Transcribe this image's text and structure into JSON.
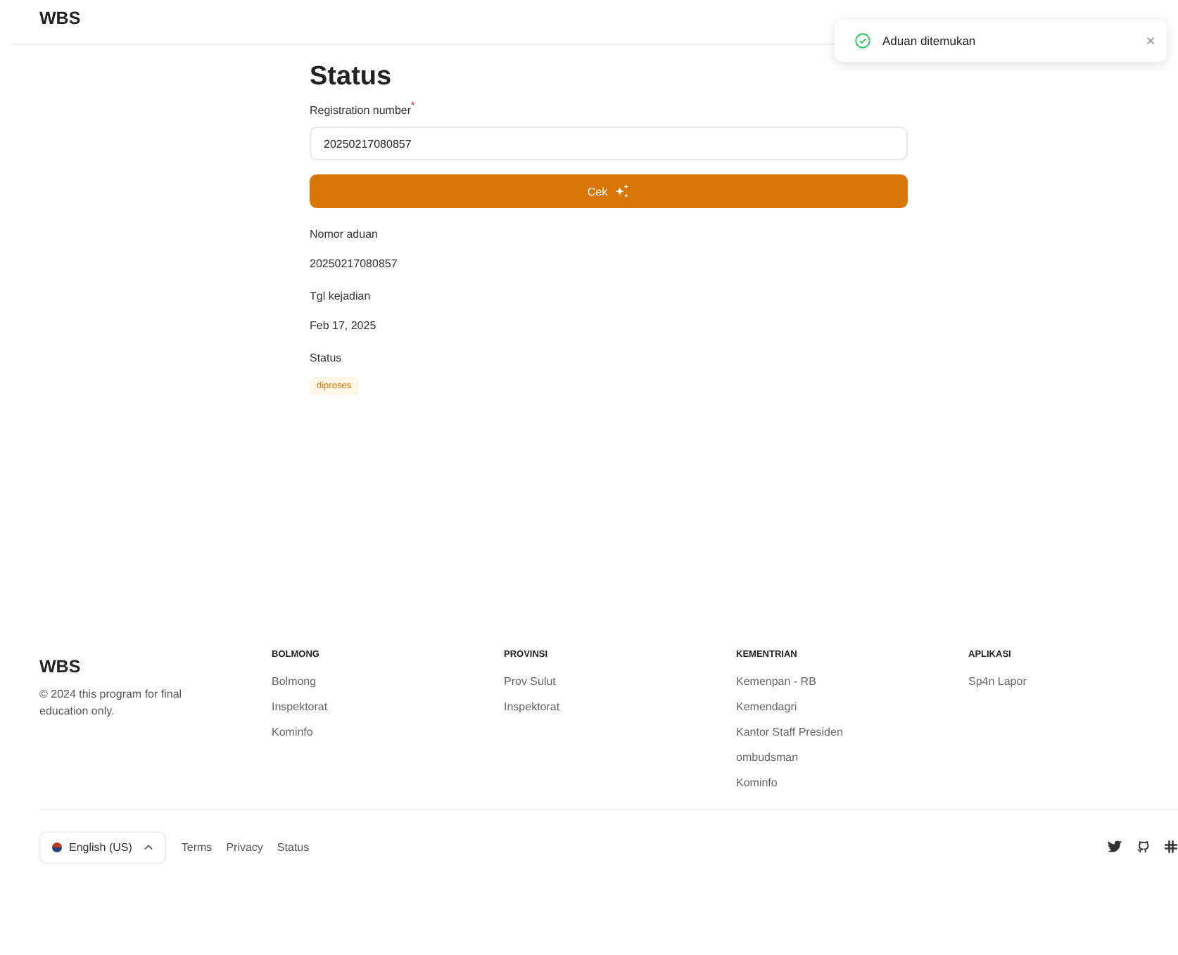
{
  "header": {
    "logo": "WBS"
  },
  "toast": {
    "message": "Aduan ditemukan",
    "close": "×"
  },
  "form": {
    "title": "Status",
    "field_label": "Registration number",
    "required_mark": "*",
    "value": "20250217080857",
    "button": "Cek"
  },
  "details": [
    {
      "kind": "text",
      "label": "Nomor aduan",
      "value": "20250217080857"
    },
    {
      "kind": "text",
      "label": "Tgl kejadian",
      "value": "Feb 17, 2025"
    },
    {
      "kind": "badge",
      "label": "Status",
      "value": "diproses"
    }
  ],
  "footer": {
    "logo": "WBS",
    "copyright": "© 2024 this program for final education only.",
    "columns": [
      {
        "heading": "BOLMONG",
        "links": [
          "Bolmong",
          "Inspektorat",
          "Kominfo"
        ]
      },
      {
        "heading": "PROVINSI",
        "links": [
          "Prov Sulut",
          "Inspektorat"
        ]
      },
      {
        "heading": "KEMENTRIAN",
        "links": [
          "Kemenpan - RB",
          "Kemendagri",
          "Kantor Staff Presiden",
          "ombudsman",
          "Kominfo"
        ]
      },
      {
        "heading": "APLIKASI",
        "links": [
          "Sp4n Lapor"
        ]
      }
    ],
    "language": "English (US)",
    "links": [
      "Terms",
      "Privacy",
      "Status"
    ]
  }
}
